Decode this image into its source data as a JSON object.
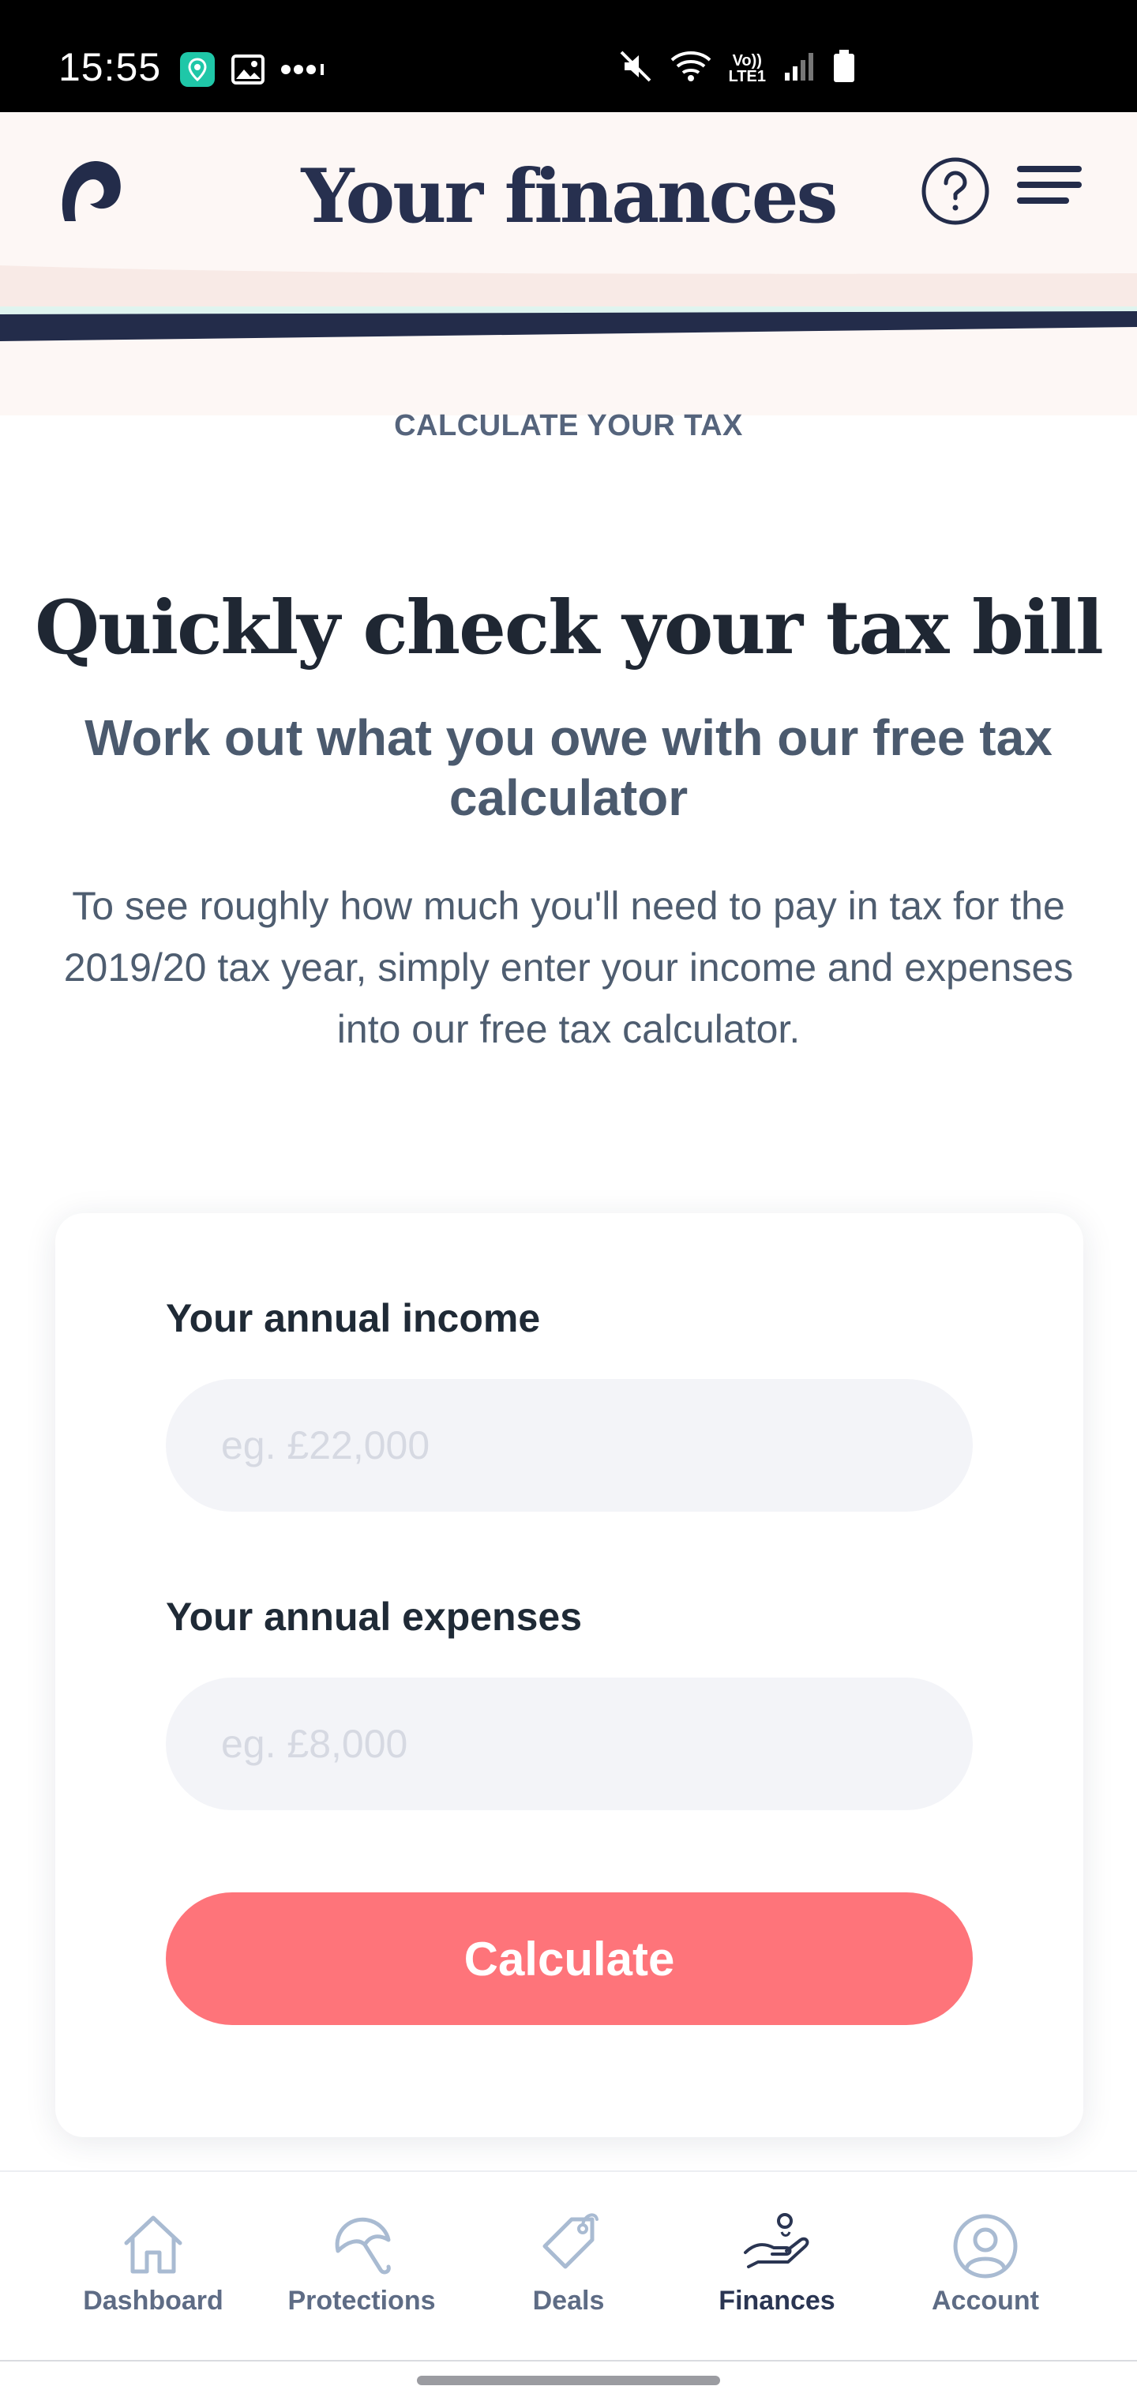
{
  "status_bar": {
    "time": "15:55",
    "left_icons": [
      "location-app-icon",
      "gallery-icon",
      "more-dots-icon"
    ],
    "right_icons": [
      "mute-icon",
      "wifi-icon",
      "volte-icon",
      "signal-icon",
      "battery-icon"
    ],
    "volte_label": "Vo))",
    "lte_label": "LTE1"
  },
  "header": {
    "title": "Your finances",
    "logo_icon": "brand-logo-icon",
    "help_icon": "question-circle-icon",
    "menu_icon": "hamburger-menu-icon"
  },
  "hero": {
    "eyebrow": "CALCULATE YOUR TAX",
    "headline": "Quickly check your tax bill",
    "subhead": "Work out what you owe with our free tax calculator",
    "intro": "To see roughly how much you'll need to pay in tax for the 2019/20 tax year, simply enter your income and expenses into our free tax calculator."
  },
  "form": {
    "income_label": "Your annual income",
    "income_placeholder": "eg. £22,000",
    "income_value": "",
    "expenses_label": "Your annual expenses",
    "expenses_placeholder": "eg. £8,000",
    "expenses_value": "",
    "submit_label": "Calculate"
  },
  "bottom_nav": {
    "items": [
      {
        "label": "Dashboard",
        "icon": "home-icon",
        "active": false
      },
      {
        "label": "Protections",
        "icon": "umbrella-icon",
        "active": false
      },
      {
        "label": "Deals",
        "icon": "tag-icon",
        "active": false
      },
      {
        "label": "Finances",
        "icon": "hand-coin-icon",
        "active": true
      },
      {
        "label": "Account",
        "icon": "user-circle-icon",
        "active": false
      }
    ]
  },
  "colors": {
    "accent": "#fe747a",
    "navy": "#27304f",
    "header_bg": "#fdf7f5",
    "input_bg": "#f3f4f8"
  }
}
